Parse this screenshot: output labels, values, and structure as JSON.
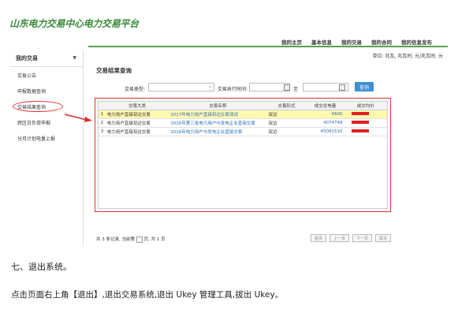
{
  "site": {
    "title": "山东电力交易中心电力交易平台"
  },
  "topnav": [
    "我的主页",
    "基本信息",
    "我的交易",
    "我的合同",
    "我的信息发布"
  ],
  "unit_label": "单位: 兆瓦, 兆瓦时, 元/兆瓦时, 元",
  "sidebar": {
    "header": "我的交易",
    "items": [
      {
        "label": "交易公告"
      },
      {
        "label": "申报数据查询"
      },
      {
        "label": "交易结果查询"
      },
      {
        "label": "跨区日负荷申报"
      },
      {
        "label": "分月计划电量上报"
      }
    ]
  },
  "panel": {
    "title": "交易结果查询",
    "filter": {
      "type_label": "交易类型:",
      "time_label": "交易执行时间:",
      "to_label": "至",
      "query_label": "查询"
    }
  },
  "table": {
    "headers": [
      "交易大类",
      "交易名称",
      "交易形式",
      "成交总电量",
      "成交均价"
    ],
    "rows": [
      {
        "idx": "1",
        "type": "电力用户直接双边交易",
        "name": "2017年电力用户直接双边交易测试",
        "form": "双边",
        "qty": "4600"
      },
      {
        "idx": "2",
        "type": "电力用户直接双边交易",
        "name": "2016年第三批电力用户与发电企业直接交易",
        "form": "双边",
        "qty": "4074748"
      },
      {
        "idx": "3",
        "type": "电力用户直接双边交易",
        "name": "2016年电力用户与发电企业直接交易",
        "form": "双边",
        "qty": "45081510"
      }
    ]
  },
  "pager": {
    "summary_pre": "共 3 条记录, 当前第",
    "summary_post": "页, 共 1 页",
    "buttons": [
      "首页",
      "上一页",
      "下一页",
      "尾页"
    ]
  },
  "doc": {
    "heading": "七、退出系统。",
    "body": "点击页面右上角【退出】,退出交易系统,退出 Ukey 管理工具,拔出 Ukey。"
  },
  "colors": {
    "brand_green": "#3a8a3a",
    "highlight_red": "#e03030",
    "button_blue": "#3d8fd4"
  }
}
